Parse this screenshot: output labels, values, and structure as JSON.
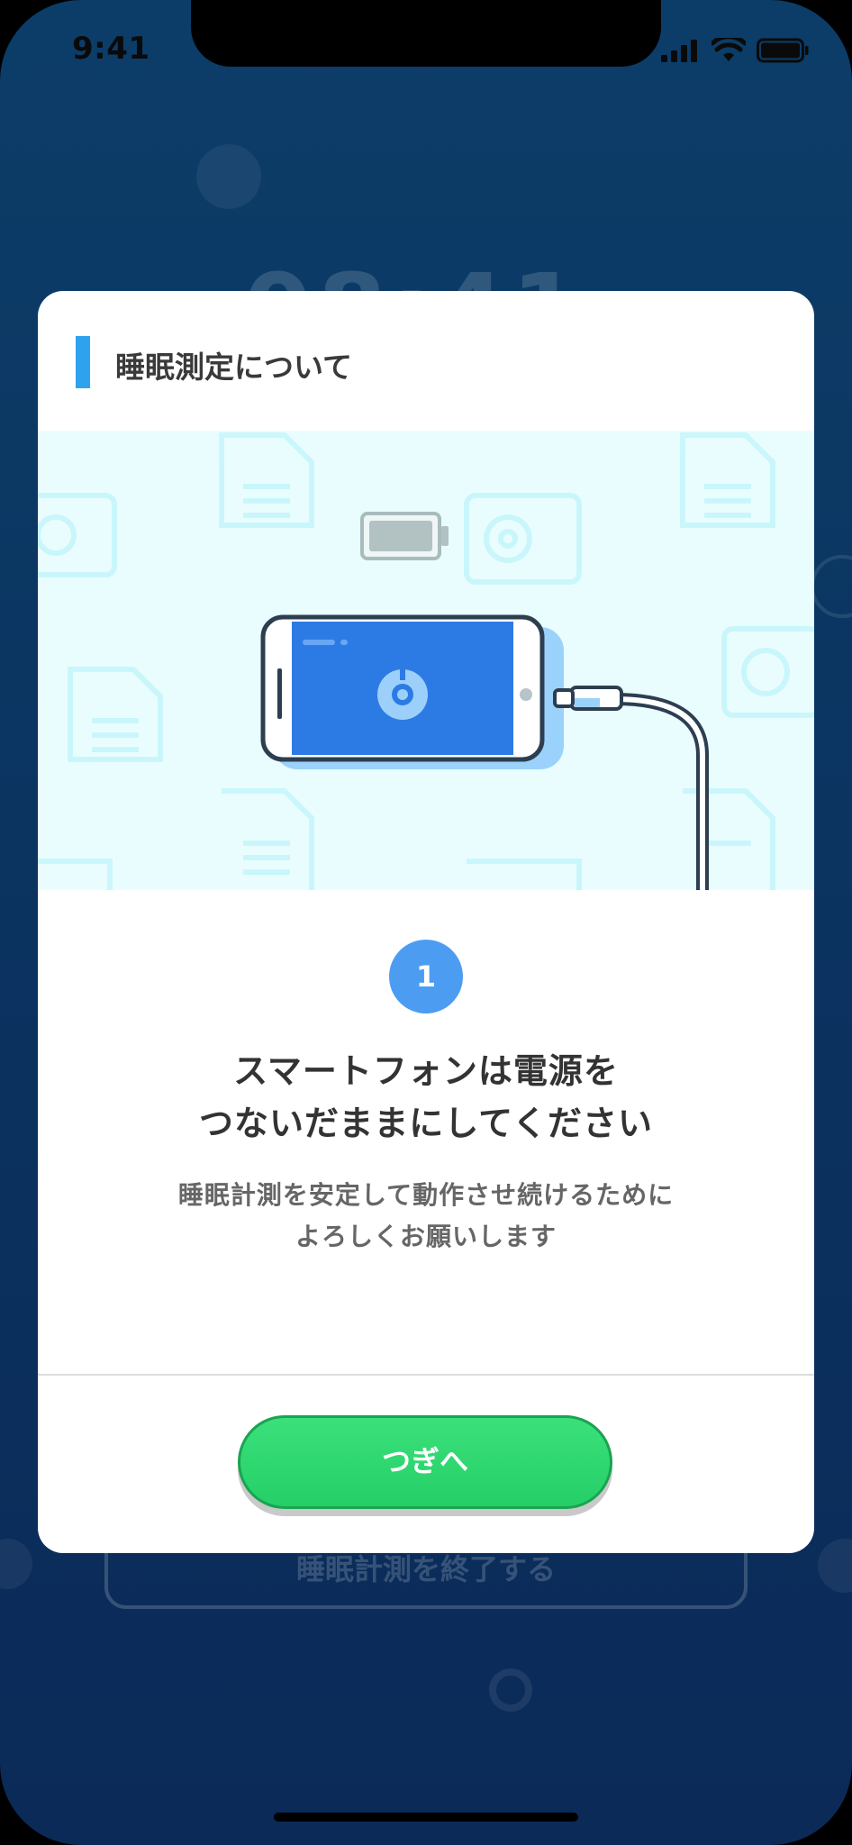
{
  "status_bar": {
    "time": "9:41"
  },
  "background": {
    "clock": "08:41",
    "end_button_label": "睡眠計測を終了する"
  },
  "modal": {
    "title": "睡眠測定について",
    "step_number": "1",
    "headline_line1": "スマートフォンは電源を",
    "headline_line2": "つないだままにしてください",
    "subtext_line1": "睡眠計測を安定して動作させ続けるために",
    "subtext_line2": "よろしくお願いします",
    "next_button_label": "つぎへ"
  },
  "colors": {
    "accent_blue": "#2fa2ee",
    "badge_blue": "#4c9df2",
    "button_green": "#2ad56c",
    "illustration_bg": "#e9fdff",
    "phone_blue": "#2c7be5"
  },
  "icons": [
    "signal-icon",
    "wifi-icon",
    "battery-icon",
    "battery-level-icon",
    "smartphone-icon",
    "charging-cable-icon",
    "app-logo-icon"
  ]
}
